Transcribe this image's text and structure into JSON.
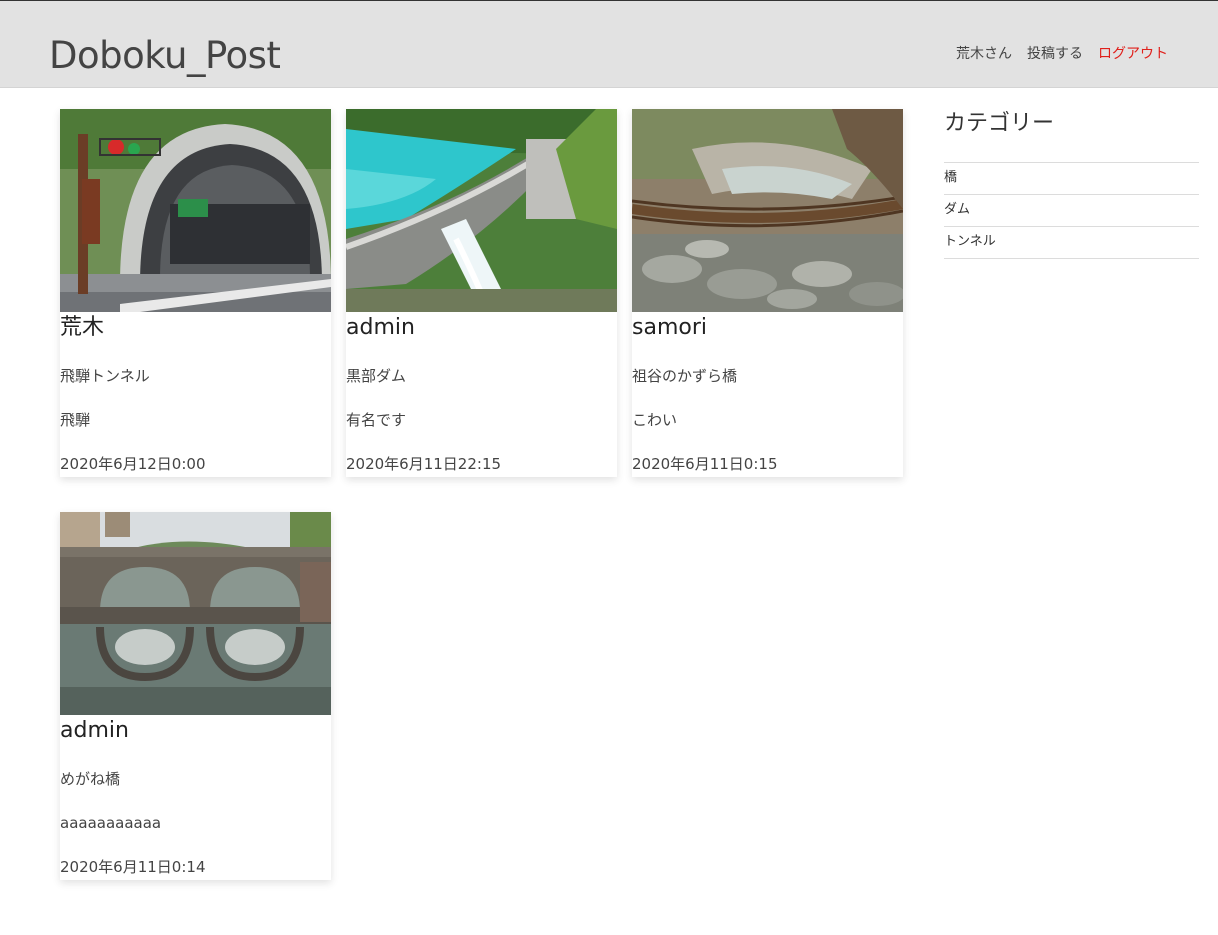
{
  "header": {
    "site_title": "Doboku_Post",
    "nav": {
      "user": "荒木さん",
      "post": "投稿する",
      "logout": "ログアウト"
    },
    "logout_color": "#e0201b"
  },
  "posts": [
    {
      "author": "荒木",
      "title": "飛騨トンネル",
      "body": "飛騨",
      "date": "2020年6月12日0:00",
      "image": "tunnel-photo"
    },
    {
      "author": "admin",
      "title": "黒部ダム",
      "body": "有名です",
      "date": "2020年6月11日22:15",
      "image": "dam-photo"
    },
    {
      "author": "samori",
      "title": "祖谷のかずら橋",
      "body": "こわい",
      "date": "2020年6月11日0:15",
      "image": "vine-bridge-photo"
    },
    {
      "author": "admin",
      "title": "めがね橋",
      "body": "aaaaaaaaaaa",
      "date": "2020年6月11日0:14",
      "image": "stone-bridge-photo"
    }
  ],
  "sidebar": {
    "heading": "カテゴリー",
    "categories": [
      "橋",
      "ダム",
      "トンネル"
    ]
  }
}
